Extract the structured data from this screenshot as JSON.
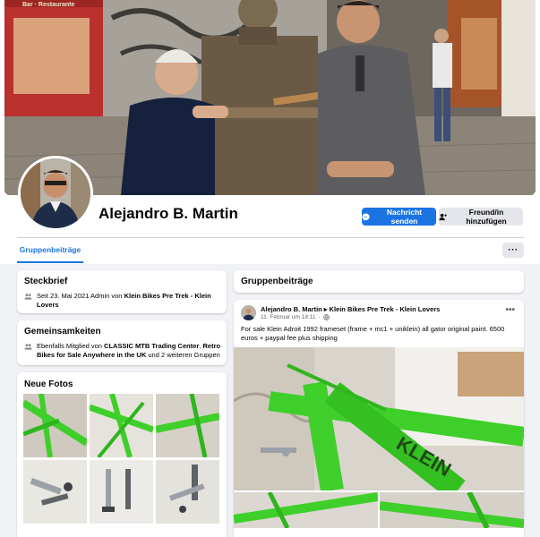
{
  "profile": {
    "name": "Alejandro B. Martin"
  },
  "actions": {
    "message_label": "Nachricht senden",
    "add_friend_label": "Freund/in hinzufügen"
  },
  "tabs": [
    {
      "label": "Gruppenbeiträge",
      "active": true
    }
  ],
  "more_label": "···",
  "cover": {
    "sign_text": "Bar · Restaurante"
  },
  "steckbrief": {
    "title": "Steckbrief",
    "line_prefix": "Seit 23. Mai 2021 Admin von ",
    "group": "Klein Bikes Pre Trek - Klein Lovers"
  },
  "gemeinsamkeiten": {
    "title": "Gemeinsamkeiten",
    "prefix": "Ebenfalls Mitglied von ",
    "group1": "CLASSIC MTB Trading Center",
    "sep": ", ",
    "group2": "Retro Bikes for Sale Anywhere in the UK",
    "suffix": " und 2 weiteren Gruppen"
  },
  "fotos": {
    "title": "Neue Fotos"
  },
  "right": {
    "section_title": "Gruppenbeiträge"
  },
  "post": {
    "author": "Alejandro B. Martin",
    "arrow": "▸",
    "group": "Klein Bikes Pre Trek - Klein Lovers",
    "date": "11. Februar um 18:11",
    "dot": "·",
    "text": "For sale Klein Adroit 1992 frameset (frame + mc1 + uniklein) all gator original paint. 6500 euros + paypal fee plus shipping",
    "dots": "•••",
    "frame_brand": "KLEIN"
  },
  "colors": {
    "accent": "#1b74e4",
    "frame_green": "#3fcf2a",
    "page_bg": "#f0f2f5"
  },
  "icons": {
    "message": "messenger-icon",
    "add_friend": "add-friend-icon",
    "group": "group-icon",
    "globe": "globe-icon"
  }
}
